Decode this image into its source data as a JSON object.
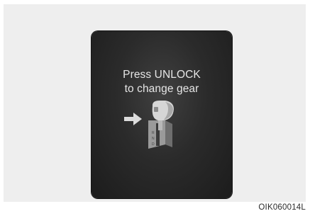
{
  "display": {
    "message_line1": "Press UNLOCK",
    "message_line2": "to change gear"
  },
  "icons": {
    "arrow": "arrow-right-icon",
    "shift_lever": "gear-shift-lever-icon"
  },
  "figure": {
    "code": "OIK060014L"
  },
  "colors": {
    "screen_bg": "#2b2b2b",
    "text": "#e6e6e6",
    "icon_light": "#dcdcdc"
  }
}
